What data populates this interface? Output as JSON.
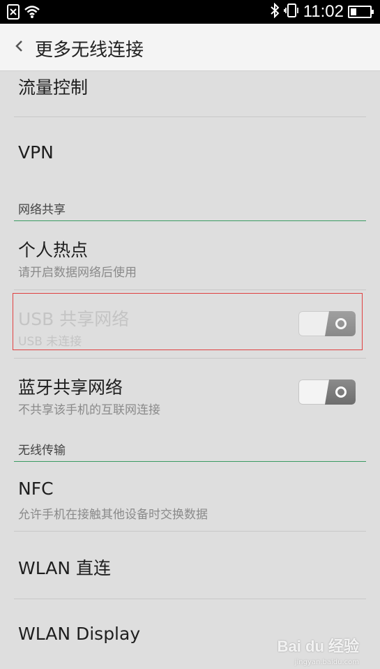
{
  "status_bar": {
    "time": "11:02",
    "left_icons": [
      "sim-card-icon",
      "wifi-icon"
    ],
    "right_icons": [
      "bluetooth-icon",
      "vibrate-icon",
      "battery-icon"
    ],
    "battery_level": 0.3
  },
  "header": {
    "title": "更多无线连接",
    "back_icon": "chevron-left-icon"
  },
  "items": {
    "traffic_control": {
      "title": "流量控制"
    },
    "vpn": {
      "title": "VPN"
    },
    "hotspot": {
      "title": "个人热点",
      "subtitle": "请开启数据网络后使用"
    },
    "usb_tethering": {
      "title": "USB 共享网络",
      "subtitle": "USB 未连接",
      "enabled": false,
      "toggle_on": false
    },
    "bt_tethering": {
      "title": "蓝牙共享网络",
      "subtitle": "不共享该手机的互联网连接",
      "toggle_on": false
    },
    "nfc": {
      "title": "NFC",
      "subtitle": "允许手机在接触其他设备时交换数据"
    },
    "wlan_direct": {
      "title": "WLAN 直连"
    },
    "wlan_display": {
      "title": "WLAN Display"
    }
  },
  "sections": {
    "network_sharing": "网络共享",
    "wireless_transfer": "无线传输"
  },
  "colors": {
    "section_line": "#3a9a62",
    "highlight_border": "#e04040",
    "toggle_knob": "#7a7a7a"
  },
  "watermark": {
    "text": "Bai du 经验",
    "sub": "jingyan.baidu.com"
  }
}
